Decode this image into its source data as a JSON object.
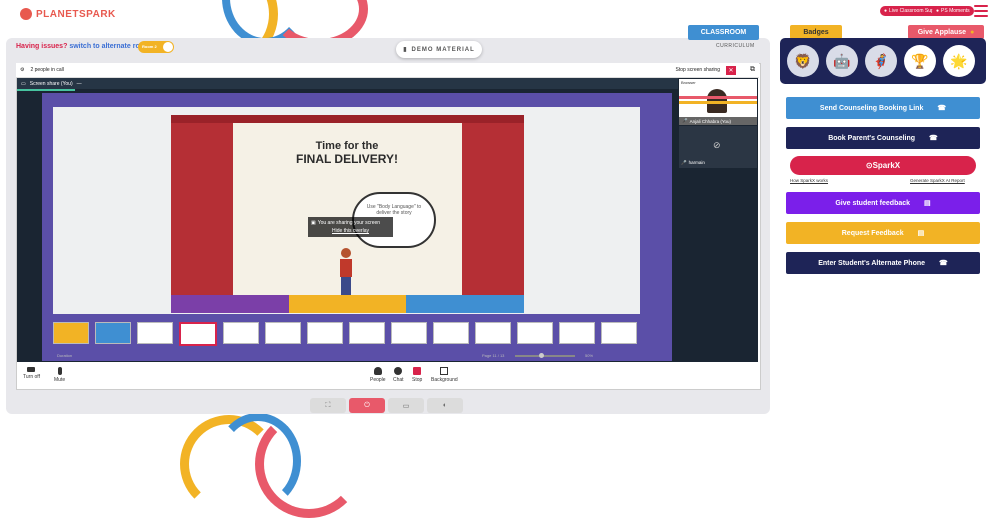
{
  "brand": {
    "logo_text": "PLANETSPARK"
  },
  "header": {
    "support_button": "Live Classroom Support",
    "moments_button": "PS Moments"
  },
  "issue_bar": {
    "prefix": "Having issues?",
    "link": "switch to alternate room",
    "toggle_label": "Room 2"
  },
  "demo_material": {
    "label": "DEMO MATERIAL"
  },
  "tabs": {
    "classroom": "CLASSROOM",
    "curriculum": "CURRICULUM",
    "badges": "Badges",
    "give_applause": "Give Applause"
  },
  "call": {
    "people_count": "2 people in call",
    "stop_sharing": "Stop screen sharing",
    "screen_share_label": "Screen share (You)",
    "participants": [
      {
        "name": "Anjali Chhabra (You)"
      },
      {
        "name": "harmain"
      }
    ],
    "participant_header": "Browser"
  },
  "slide": {
    "title_line1": "Time for the",
    "title_line2": "FINAL DELIVERY!",
    "cloud_text": "Use \"Body Language\" to deliver the story",
    "overlay_text": "You are sharing your screen",
    "overlay_link": "Hide this overlay",
    "page_indicator": "Page 11 / 13",
    "zoom": "50%",
    "duration_label": "Duration"
  },
  "controls": {
    "turn_off": "Turn off",
    "mute": "Mute",
    "people": "People",
    "chat": "Chat",
    "stop": "Stop",
    "background": "Background"
  },
  "actions": {
    "counseling_link": "Send Counseling Booking Link",
    "parents_counseling": "Book Parent's Counseling",
    "sparkx": "SparkX",
    "how_sparkx": "How SparkX works",
    "generate_report": "Generate SparkX AI Report",
    "student_feedback": "Give student feedback",
    "request_feedback": "Request Feedback",
    "alternate_phone": "Enter Student's Alternate Phone"
  },
  "colors": {
    "brand_red": "#d8234b",
    "blue": "#3f8fd2",
    "navy": "#1e2457",
    "purple": "#7b1fea",
    "orange": "#f2b325"
  }
}
